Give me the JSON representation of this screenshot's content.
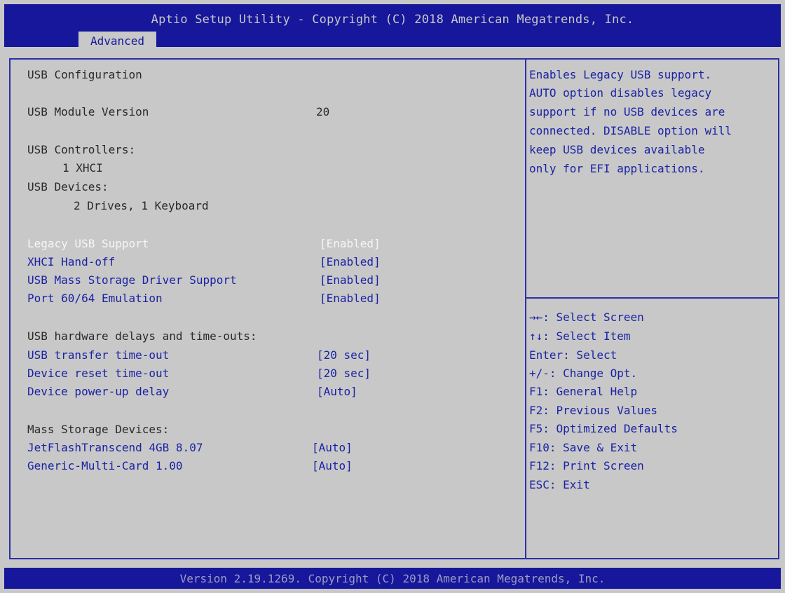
{
  "header": {
    "title": "Aptio Setup Utility - Copyright (C) 2018 American Megatrends, Inc.",
    "tab": "Advanced"
  },
  "main": {
    "section_title": "USB Configuration",
    "module_version_label": "USB Module Version",
    "module_version_value": "20",
    "controllers_label": "USB Controllers:",
    "controllers_value": "1 XHCI",
    "devices_label": "USB Devices:",
    "devices_value": "2 Drives, 1 Keyboard",
    "options": [
      {
        "label": "Legacy USB Support",
        "value": "[Enabled]"
      },
      {
        "label": "XHCI Hand-off",
        "value": "[Enabled]"
      },
      {
        "label": "USB Mass Storage Driver Support",
        "value": "[Enabled]"
      },
      {
        "label": "Port 60/64 Emulation",
        "value": "[Enabled]"
      }
    ],
    "delays_heading": "USB hardware delays and time-outs:",
    "delay_options": [
      {
        "label": "USB transfer time-out",
        "value": "[20 sec]"
      },
      {
        "label": "Device reset time-out",
        "value": "[20 sec]"
      },
      {
        "label": "Device power-up delay",
        "value": "[Auto]"
      }
    ],
    "mass_storage_heading": "Mass Storage Devices:",
    "mass_storage_devices": [
      {
        "label": "JetFlashTranscend 4GB 8.07",
        "value": "[Auto]"
      },
      {
        "label": "Generic-Multi-Card 1.00",
        "value": "[Auto]"
      }
    ]
  },
  "help": {
    "description": [
      "Enables Legacy USB support.",
      "AUTO option disables legacy",
      "support if no USB devices are",
      "connected. DISABLE option will",
      "keep USB devices available",
      "only for EFI applications."
    ],
    "keys": [
      "→←: Select Screen",
      "↑↓: Select Item",
      "Enter: Select",
      "+/-: Change Opt.",
      "F1: General Help",
      "F2: Previous Values",
      "F5: Optimized Defaults",
      "F10: Save & Exit",
      "F12: Print Screen",
      "ESC: Exit"
    ]
  },
  "footer": {
    "text": "Version 2.19.1269. Copyright (C) 2018 American Megatrends, Inc."
  },
  "colors": {
    "header_bg": "#16179a",
    "screen_bg": "#c8c8c8",
    "option_text": "#1a22a4",
    "selected_text": "#f6f6f6"
  }
}
